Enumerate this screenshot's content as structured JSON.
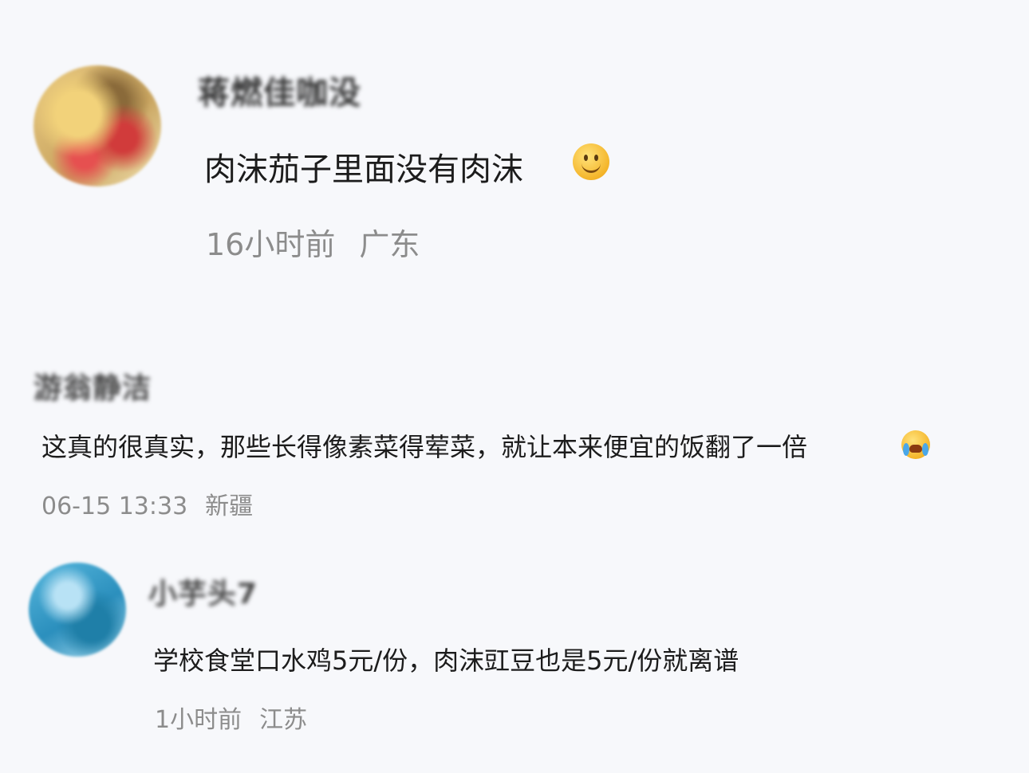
{
  "comments": [
    {
      "username": "蒋燃佳咖没",
      "text": "肉沫茄子里面没有肉沫",
      "emoji": "smile-emoji",
      "time": "16小时前",
      "location": "广东"
    },
    {
      "username": "游翁静洁",
      "text": "这真的很真实，那些长得像素菜得荤菜，就让本来便宜的饭翻了一倍",
      "emoji": "laugh-cry-emoji",
      "time": "06-15 13:33",
      "location": "新疆"
    },
    {
      "username": "小芋头7",
      "text": "学校食堂口水鸡5元/份，肉沫豇豆也是5元/份就离谱",
      "time": "1小时前",
      "location": "江苏"
    }
  ]
}
